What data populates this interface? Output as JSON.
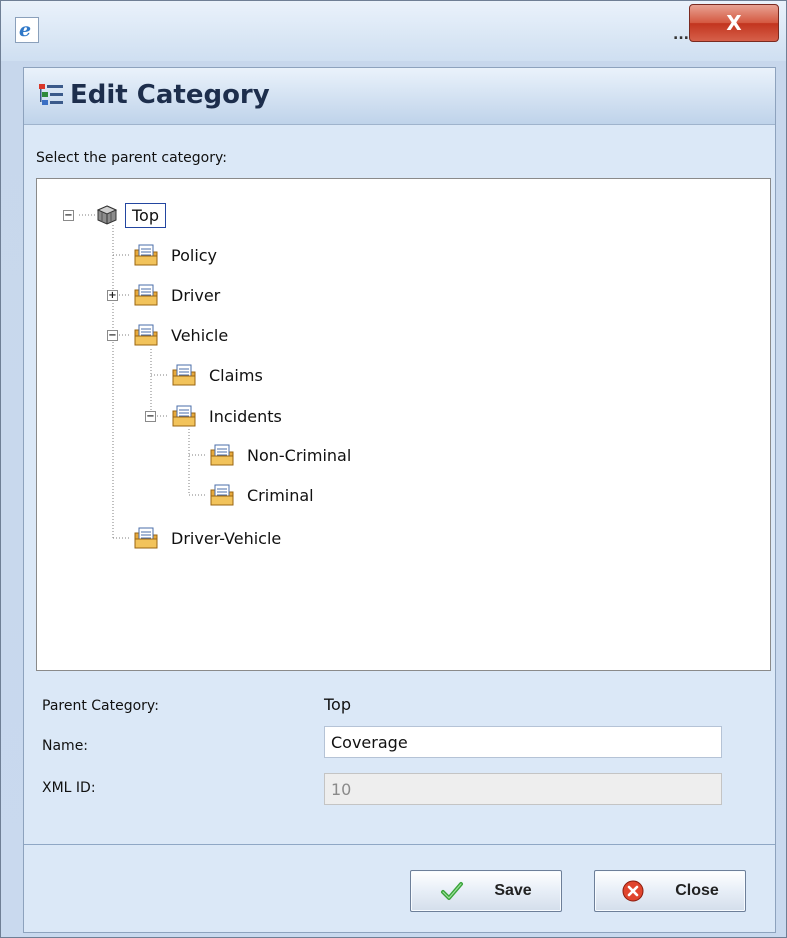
{
  "window": {
    "browser_icon": "internet-explorer-icon",
    "title_ellipsis": "...",
    "close_glyph": "X"
  },
  "dialog": {
    "icon": "category-tree-icon",
    "title": "Edit Category",
    "prompt": "Select the parent category:"
  },
  "tree": {
    "root": {
      "label": "Top",
      "icon": "cube-stack-icon",
      "expander": "−"
    },
    "nodes": [
      {
        "label": "Policy",
        "icon": "folder-icon"
      },
      {
        "label": "Driver",
        "icon": "folder-icon",
        "expander": "+"
      },
      {
        "label": "Vehicle",
        "icon": "folder-icon",
        "expander": "−"
      },
      {
        "label": "Claims",
        "icon": "folder-icon"
      },
      {
        "label": "Incidents",
        "icon": "folder-icon",
        "expander": "−"
      },
      {
        "label": "Non-Criminal",
        "icon": "folder-icon"
      },
      {
        "label": "Criminal",
        "icon": "folder-icon"
      },
      {
        "label": "Driver-Vehicle",
        "icon": "folder-icon"
      }
    ]
  },
  "form": {
    "parent_label": "Parent Category:",
    "parent_value": "Top",
    "name_label": "Name:",
    "name_value": "Coverage",
    "xmlid_label": "XML ID:",
    "xmlid_value": "10"
  },
  "buttons": {
    "save_label": "Save",
    "save_icon": "checkmark-icon",
    "close_label": "Close",
    "close_icon": "close-circle-icon"
  },
  "colors": {
    "header_title": "#1d2e4c",
    "close_button": "#c2341e",
    "selection_border": "#2346a0",
    "check_green": "#3aa33a"
  }
}
